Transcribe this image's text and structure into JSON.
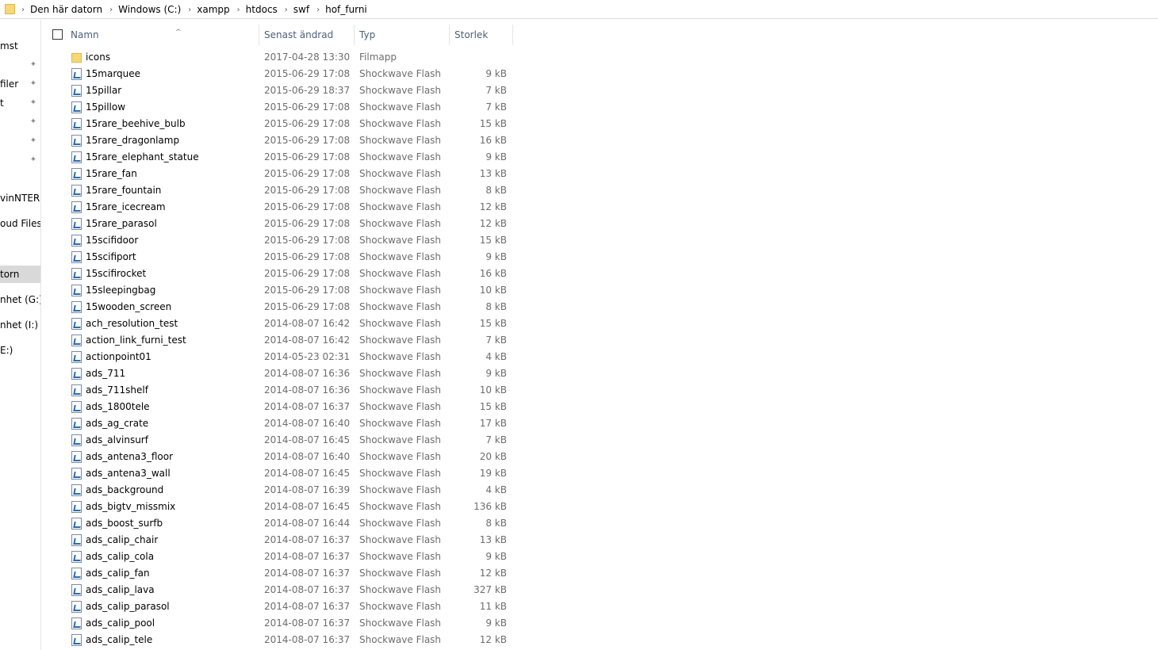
{
  "address": {
    "crumbs": [
      "Den här datorn",
      "Windows (C:)",
      "xampp",
      "htdocs",
      "swf",
      "hof_furni"
    ]
  },
  "nav": {
    "items": [
      {
        "label": "mst",
        "pinned": false
      },
      {
        "label": "",
        "pinned": true
      },
      {
        "label": "filer",
        "pinned": true
      },
      {
        "label": "t",
        "pinned": true
      },
      {
        "label": "",
        "pinned": true
      },
      {
        "label": "",
        "pinned": true
      },
      {
        "label": "",
        "pinned": true
      },
      {
        "label": "vinNTERN",
        "pinned": false
      },
      {
        "label": "oud Files",
        "pinned": false
      },
      {
        "label": "torn",
        "pinned": false,
        "selected": true
      },
      {
        "label": "nhet (G:) N",
        "pinned": false
      },
      {
        "label": "nhet (I:) TI",
        "pinned": false
      },
      {
        "label": "E:)",
        "pinned": false
      }
    ]
  },
  "columns": {
    "name": "Namn",
    "date": "Senast ändrad",
    "type": "Typ",
    "size": "Storlek"
  },
  "files": [
    {
      "name": "icons",
      "date": "2017-04-28 13:30",
      "type": "Filmapp",
      "size": "",
      "icon": "folder-icon"
    },
    {
      "name": "15marquee",
      "date": "2015-06-29 17:08",
      "type": "Shockwave Flash",
      "size": "9 kB",
      "icon": "swf-file-icon"
    },
    {
      "name": "15pillar",
      "date": "2015-06-29 18:37",
      "type": "Shockwave Flash",
      "size": "7 kB",
      "icon": "swf-file-icon"
    },
    {
      "name": "15pillow",
      "date": "2015-06-29 17:08",
      "type": "Shockwave Flash",
      "size": "7 kB",
      "icon": "swf-file-icon"
    },
    {
      "name": "15rare_beehive_bulb",
      "date": "2015-06-29 17:08",
      "type": "Shockwave Flash",
      "size": "15 kB",
      "icon": "swf-file-icon"
    },
    {
      "name": "15rare_dragonlamp",
      "date": "2015-06-29 17:08",
      "type": "Shockwave Flash",
      "size": "16 kB",
      "icon": "swf-file-icon"
    },
    {
      "name": "15rare_elephant_statue",
      "date": "2015-06-29 17:08",
      "type": "Shockwave Flash",
      "size": "9 kB",
      "icon": "swf-file-icon"
    },
    {
      "name": "15rare_fan",
      "date": "2015-06-29 17:08",
      "type": "Shockwave Flash",
      "size": "13 kB",
      "icon": "swf-file-icon"
    },
    {
      "name": "15rare_fountain",
      "date": "2015-06-29 17:08",
      "type": "Shockwave Flash",
      "size": "8 kB",
      "icon": "swf-file-icon"
    },
    {
      "name": "15rare_icecream",
      "date": "2015-06-29 17:08",
      "type": "Shockwave Flash",
      "size": "12 kB",
      "icon": "swf-file-icon"
    },
    {
      "name": "15rare_parasol",
      "date": "2015-06-29 17:08",
      "type": "Shockwave Flash",
      "size": "12 kB",
      "icon": "swf-file-icon"
    },
    {
      "name": "15scifidoor",
      "date": "2015-06-29 17:08",
      "type": "Shockwave Flash",
      "size": "15 kB",
      "icon": "swf-file-icon"
    },
    {
      "name": "15scifiport",
      "date": "2015-06-29 17:08",
      "type": "Shockwave Flash",
      "size": "9 kB",
      "icon": "swf-file-icon"
    },
    {
      "name": "15scifirocket",
      "date": "2015-06-29 17:08",
      "type": "Shockwave Flash",
      "size": "16 kB",
      "icon": "swf-file-icon"
    },
    {
      "name": "15sleepingbag",
      "date": "2015-06-29 17:08",
      "type": "Shockwave Flash",
      "size": "10 kB",
      "icon": "swf-file-icon"
    },
    {
      "name": "15wooden_screen",
      "date": "2015-06-29 17:08",
      "type": "Shockwave Flash",
      "size": "8 kB",
      "icon": "swf-file-icon"
    },
    {
      "name": "ach_resolution_test",
      "date": "2014-08-07 16:42",
      "type": "Shockwave Flash",
      "size": "15 kB",
      "icon": "swf-file-icon"
    },
    {
      "name": "action_link_furni_test",
      "date": "2014-08-07 16:42",
      "type": "Shockwave Flash",
      "size": "7 kB",
      "icon": "swf-file-icon"
    },
    {
      "name": "actionpoint01",
      "date": "2014-05-23 02:31",
      "type": "Shockwave Flash",
      "size": "4 kB",
      "icon": "swf-file-icon"
    },
    {
      "name": "ads_711",
      "date": "2014-08-07 16:36",
      "type": "Shockwave Flash",
      "size": "9 kB",
      "icon": "swf-file-icon"
    },
    {
      "name": "ads_711shelf",
      "date": "2014-08-07 16:36",
      "type": "Shockwave Flash",
      "size": "10 kB",
      "icon": "swf-file-icon"
    },
    {
      "name": "ads_1800tele",
      "date": "2014-08-07 16:37",
      "type": "Shockwave Flash",
      "size": "15 kB",
      "icon": "swf-file-icon"
    },
    {
      "name": "ads_ag_crate",
      "date": "2014-08-07 16:40",
      "type": "Shockwave Flash",
      "size": "17 kB",
      "icon": "swf-file-icon"
    },
    {
      "name": "ads_alvinsurf",
      "date": "2014-08-07 16:45",
      "type": "Shockwave Flash",
      "size": "7 kB",
      "icon": "swf-file-icon"
    },
    {
      "name": "ads_antena3_floor",
      "date": "2014-08-07 16:40",
      "type": "Shockwave Flash",
      "size": "20 kB",
      "icon": "swf-file-icon"
    },
    {
      "name": "ads_antena3_wall",
      "date": "2014-08-07 16:45",
      "type": "Shockwave Flash",
      "size": "19 kB",
      "icon": "swf-file-icon"
    },
    {
      "name": "ads_background",
      "date": "2014-08-07 16:39",
      "type": "Shockwave Flash",
      "size": "4 kB",
      "icon": "swf-file-icon"
    },
    {
      "name": "ads_bigtv_missmix",
      "date": "2014-08-07 16:45",
      "type": "Shockwave Flash",
      "size": "136 kB",
      "icon": "swf-file-icon"
    },
    {
      "name": "ads_boost_surfb",
      "date": "2014-08-07 16:44",
      "type": "Shockwave Flash",
      "size": "8 kB",
      "icon": "swf-file-icon"
    },
    {
      "name": "ads_calip_chair",
      "date": "2014-08-07 16:37",
      "type": "Shockwave Flash",
      "size": "13 kB",
      "icon": "swf-file-icon"
    },
    {
      "name": "ads_calip_cola",
      "date": "2014-08-07 16:37",
      "type": "Shockwave Flash",
      "size": "9 kB",
      "icon": "swf-file-icon"
    },
    {
      "name": "ads_calip_fan",
      "date": "2014-08-07 16:37",
      "type": "Shockwave Flash",
      "size": "12 kB",
      "icon": "swf-file-icon"
    },
    {
      "name": "ads_calip_lava",
      "date": "2014-08-07 16:37",
      "type": "Shockwave Flash",
      "size": "327 kB",
      "icon": "swf-file-icon"
    },
    {
      "name": "ads_calip_parasol",
      "date": "2014-08-07 16:37",
      "type": "Shockwave Flash",
      "size": "11 kB",
      "icon": "swf-file-icon"
    },
    {
      "name": "ads_calip_pool",
      "date": "2014-08-07 16:37",
      "type": "Shockwave Flash",
      "size": "9 kB",
      "icon": "swf-file-icon"
    },
    {
      "name": "ads_calip_tele",
      "date": "2014-08-07 16:37",
      "type": "Shockwave Flash",
      "size": "12 kB",
      "icon": "swf-file-icon"
    }
  ]
}
